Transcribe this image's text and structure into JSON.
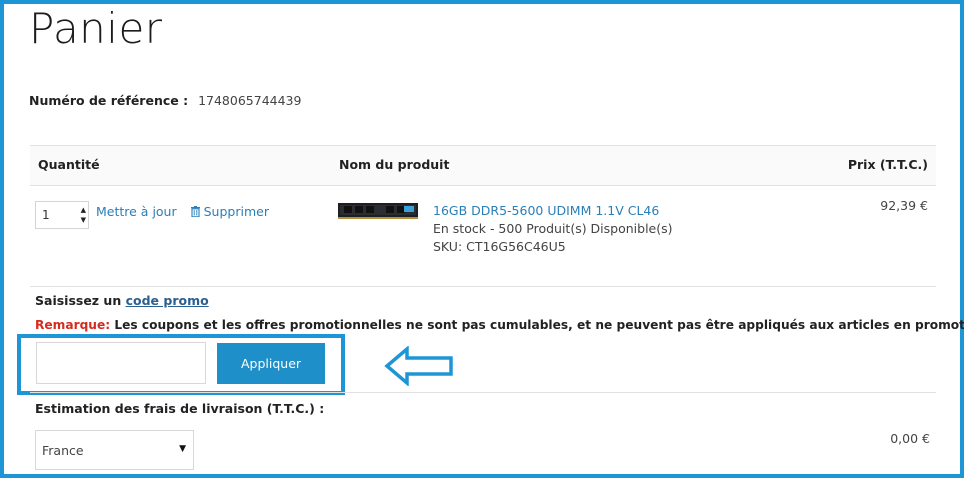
{
  "page": {
    "title": "Panier",
    "reference_label": "Numéro de référence :",
    "reference_value": "1748065744439"
  },
  "table": {
    "headers": {
      "quantity": "Quantité",
      "product_name": "Nom du produit",
      "price": "Prix (T.T.C.)"
    },
    "item": {
      "quantity": "1",
      "update_label": "Mettre à jour",
      "delete_label": "Supprimer",
      "name": "16GB DDR5-5600 UDIMM 1.1V CL46",
      "stock": "En stock - 500  Produit(s) Disponible(s)",
      "sku": "SKU: CT16G56C46U5",
      "price": "92,39 €"
    }
  },
  "promo": {
    "label_prefix": "Saisissez un",
    "label_link": "code promo",
    "remark_label": "Remarque:",
    "remark_text": " Les coupons et les offres promotionnelles ne sont pas cumulables, et ne peuvent pas être appliqués aux articles en promotion.",
    "input_value": "",
    "apply_label": "Appliquer"
  },
  "shipping": {
    "label": "Estimation des frais de livraison (T.T.C.) :",
    "country_selected": "France",
    "price": "0,00 €"
  },
  "colors": {
    "accent": "#1e96d6",
    "button": "#1e8fc9",
    "link": "#2a7fb8",
    "remark": "#d62b1f"
  },
  "icons": {
    "trash": "trash-icon",
    "arrow": "left-arrow-icon",
    "caret": "caret-down-icon",
    "spinner": "quantity-spinner-icon"
  }
}
